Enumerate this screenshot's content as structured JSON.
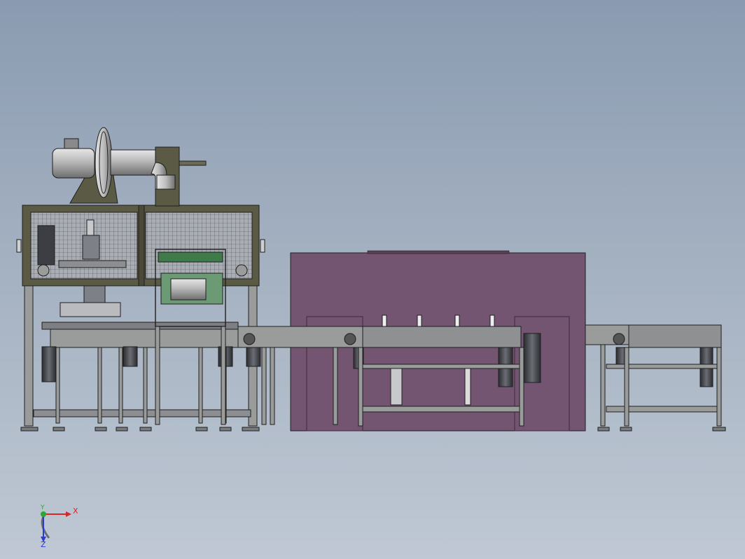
{
  "viewport": {
    "background_top": "#8a9bb1",
    "background_bottom": "#bfc8d4"
  },
  "model": {
    "frame_color": "#5b5a45",
    "mesh_color": "#aab0b8",
    "oven_color": "#735572",
    "steel_color": "#9a9c9c",
    "motor_color": "#3c3e44",
    "outline_color": "#1e1e1e",
    "accent_green": "#3f7a4a"
  },
  "triad": {
    "x_label": "X",
    "y_label": "Y",
    "z_label": "Z",
    "x_color": "#d8262a",
    "y_color": "#2aa830",
    "z_color": "#2b3bd0"
  }
}
